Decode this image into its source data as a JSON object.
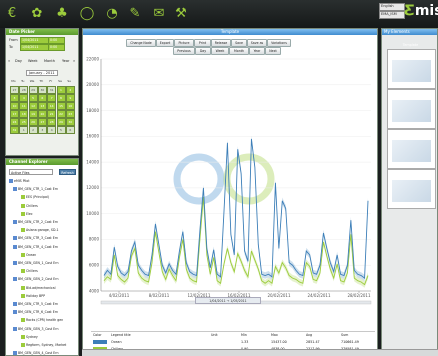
{
  "toolbar": {
    "icons": [
      "currency-icon",
      "plant-icon",
      "tree-icon",
      "bag-icon",
      "gauge-icon",
      "pencil-icon",
      "envelope-icon",
      "tools-icon"
    ]
  },
  "brand": {
    "language": "English",
    "site": "EMA_ISM",
    "logo_e": "Ƹ",
    "logo_text": "mis"
  },
  "date_picker": {
    "title": "Date Picker",
    "from_label": "From",
    "from_date": "1/04/2011",
    "from_time": "0:00",
    "to_label": "To",
    "to_date": "1/04/2011",
    "to_time": "0:00",
    "views": [
      "Day",
      "Week",
      "Month",
      "Year"
    ],
    "nav_prev": "«",
    "nav_next": "»",
    "month": "January - 2011",
    "weekdays": [
      "Mo",
      "Tu",
      "We",
      "Th",
      "Fr",
      "Sa",
      "Su"
    ],
    "days": [
      [
        "27",
        "28",
        "29",
        "30",
        "31",
        "1",
        "2"
      ],
      [
        "3",
        "4",
        "5",
        "6",
        "7",
        "8",
        "9"
      ],
      [
        "10",
        "11",
        "12",
        "13",
        "14",
        "15",
        "16"
      ],
      [
        "17",
        "18",
        "19",
        "20",
        "21",
        "22",
        "23"
      ],
      [
        "24",
        "25",
        "26",
        "27",
        "28",
        "29",
        "30"
      ],
      [
        "31",
        "1",
        "2",
        "3",
        "4",
        "5",
        "6"
      ]
    ]
  },
  "explorer": {
    "title": "Channel Explorer",
    "filter": "Active Files",
    "refresh": "Refresh",
    "items": [
      "eMIS Pilot",
      "BM_GEN_CTR_1_Cost Ern",
      "EES (Principal)",
      "Chillers",
      "Elec",
      "BM_GEN_CTR_2_Cost Ern",
      "Asiana garage, SD-1",
      "BM_GEN_CTR_3_Cost Ern",
      "BM_GEN_CTR_4_Cost Ern",
      "Ocean",
      "BM_GEN_GEN_1_Cost Ern",
      "Chillers",
      "BM_GEN_GEN_2_Cost Ern",
      "Bld.ad/mechanical",
      "Holiday BPP",
      "BM_GEN_CTR_5_Cost Ern",
      "BM_GEN_CTR_6_Cost Ern",
      "Rocks (CPR) health gen",
      "BM_GEN_GEN_3_Cost Ern",
      "Sydney",
      "Regform, Sydney, Market",
      "BM_GEN_GEN_4_Cost Ern"
    ]
  },
  "template": {
    "title": "Template",
    "buttons_row1": [
      "Change Node",
      "Export",
      "Picture",
      "Print",
      "Release",
      "Save",
      "Save as",
      "Variations"
    ],
    "buttons_row2": [
      "Previous",
      "Day",
      "Week",
      "Month",
      "Year",
      "Next"
    ],
    "date_range_nav": "1/04/2011 → 1/05/2011"
  },
  "chart_data": {
    "type": "line",
    "ylim": [
      4000,
      22000
    ],
    "yticks": [
      4000,
      6000,
      8000,
      10000,
      12000,
      14000,
      16000,
      18000,
      20000,
      22000
    ],
    "xticks": [
      "4/02/2011",
      "8/02/2011",
      "12/02/2011",
      "16/02/2011",
      "20/02/2011",
      "24/02/2011",
      "28/02/2011"
    ],
    "series": [
      {
        "name": "Ocean",
        "color": "#3d7fb8",
        "values": [
          5200,
          5600,
          5300,
          7400,
          5900,
          5400,
          5200,
          5500,
          7100,
          7800,
          6000,
          5600,
          5300,
          5200,
          6800,
          9200,
          7600,
          6000,
          5400,
          6100,
          5600,
          5300,
          7100,
          8600,
          6200,
          5500,
          5300,
          5200,
          8800,
          12000,
          7300,
          5800,
          7200,
          5300,
          5100,
          10200,
          15500,
          8400,
          6800,
          15000,
          13100,
          7100,
          6300,
          15800,
          13600,
          7600,
          5300,
          5200,
          5300,
          5100,
          12400,
          7300,
          11000,
          10400,
          6200,
          6000,
          5600,
          5300,
          5200,
          7100,
          6800,
          5400,
          5300,
          6000,
          8500,
          7300,
          6200,
          5500,
          6800,
          5300,
          5200,
          6000,
          9500,
          5600,
          5300,
          5200,
          5000,
          11000
        ]
      },
      {
        "name": "Chillers",
        "color": "#9ccc3c",
        "values": [
          4800,
          5100,
          4900,
          6800,
          5200,
          4900,
          4700,
          5000,
          6700,
          7300,
          5400,
          5000,
          4800,
          4700,
          6200,
          8600,
          7000,
          5500,
          4900,
          5700,
          5200,
          4800,
          6600,
          8000,
          5700,
          5000,
          4800,
          4700,
          8100,
          11300,
          6800,
          5300,
          6600,
          4800,
          4600,
          6100,
          7300,
          6200,
          5500,
          6900,
          6300,
          5600,
          5100,
          7100,
          6400,
          5700,
          4800,
          4600,
          4800,
          4600,
          5900,
          5400,
          6200,
          5800,
          5200,
          5000,
          4900,
          4700,
          4600,
          6200,
          5900,
          4900,
          4800,
          5400,
          7800,
          6700,
          5700,
          5000,
          6100,
          4800,
          4700,
          5400,
          8400,
          5000,
          4800,
          4700,
          4500,
          5200
        ]
      }
    ]
  },
  "legend": {
    "headers": [
      "Color",
      "Legend title",
      "Unit",
      "Min",
      "Max",
      "Avg",
      "Sum"
    ],
    "rows": [
      {
        "color": "#3d7fb8",
        "title": "Ocean",
        "unit": "",
        "min": "1.33",
        "max": "15437.00",
        "avg": "2851.47",
        "sum": "710661.49"
      },
      {
        "color": "#9ccc3c",
        "title": "Chillers",
        "unit": "",
        "min": "0.90",
        "max": "4838.00",
        "avg": "2317.99",
        "sum": "379581.49"
      }
    ]
  },
  "elements": {
    "title": "My Elements",
    "thumbs": [
      "Template",
      "Template",
      "Treeview",
      "Treeview"
    ]
  }
}
